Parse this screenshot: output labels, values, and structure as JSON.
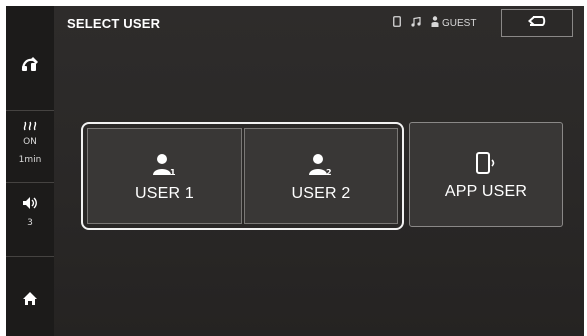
{
  "header": {
    "title": "SELECT USER",
    "status": {
      "user_label": "GUEST",
      "icons": [
        "phone-icon",
        "music-note-icon",
        "person-icon"
      ]
    },
    "back_icon": "return-arrow-icon"
  },
  "sidebar": {
    "top_icon": "headphone-edit-icon",
    "auto_off": {
      "icon": "heat-waves-icon",
      "state": "ON",
      "time": "1min"
    },
    "volume": {
      "icon": "speaker-icon",
      "level": "3"
    },
    "home_icon": "home-icon"
  },
  "users": [
    {
      "label": "USER 1",
      "icon": "user-1-icon",
      "badge": "1",
      "selected": true
    },
    {
      "label": "USER 2",
      "icon": "user-2-icon",
      "badge": "2",
      "selected": true
    },
    {
      "label": "APP USER",
      "icon": "phone-broadcast-icon",
      "selected": false
    }
  ],
  "colors": {
    "background": "#2c2a29",
    "sidebar": "#1c1b1a",
    "button": "#393736",
    "selection": "#f2f2f2"
  }
}
